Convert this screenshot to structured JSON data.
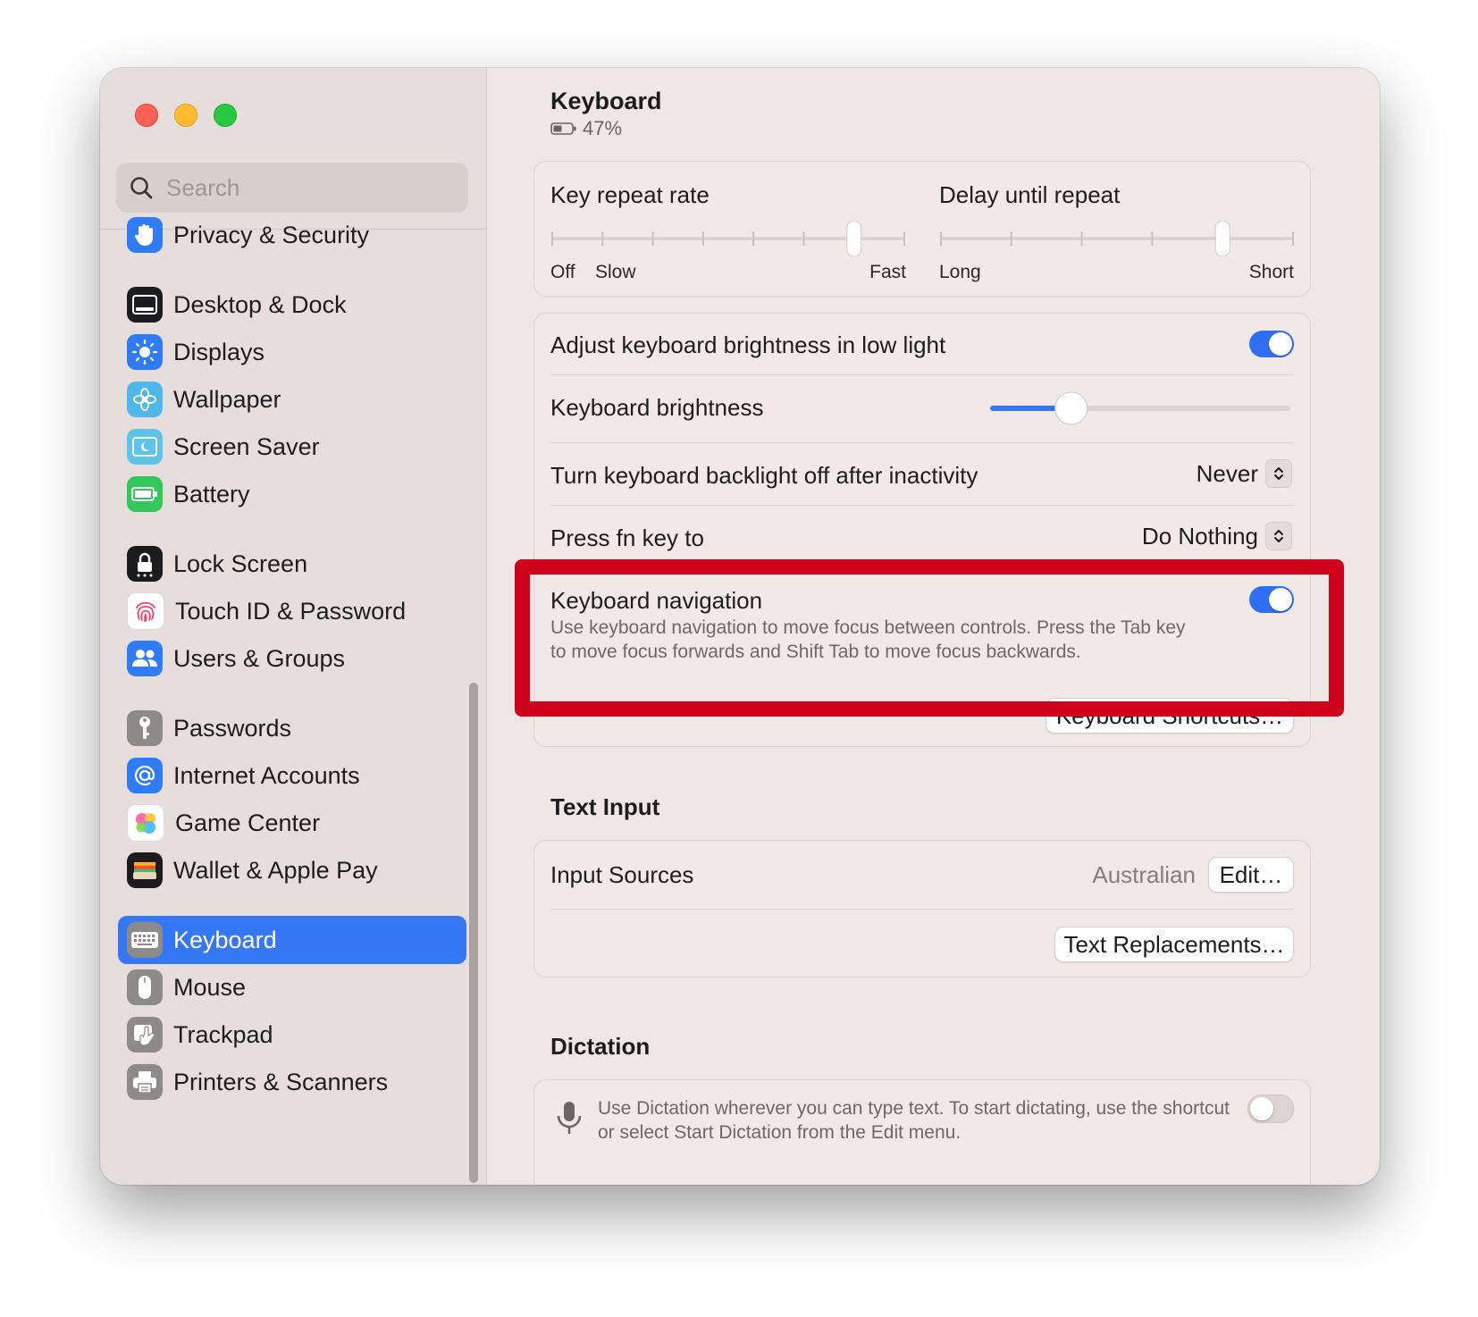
{
  "window": {
    "title": "Keyboard"
  },
  "search": {
    "placeholder": "Search"
  },
  "sidebar": {
    "items": [
      {
        "label": "Privacy & Security",
        "icon": "hand-icon"
      },
      {
        "label": "Desktop & Dock",
        "icon": "dock-icon"
      },
      {
        "label": "Displays",
        "icon": "sun-icon"
      },
      {
        "label": "Wallpaper",
        "icon": "flower-icon"
      },
      {
        "label": "Screen Saver",
        "icon": "screen-saver-icon"
      },
      {
        "label": "Battery",
        "icon": "battery-icon"
      },
      {
        "label": "Lock Screen",
        "icon": "lock-icon"
      },
      {
        "label": "Touch ID & Password",
        "icon": "fingerprint-icon"
      },
      {
        "label": "Users & Groups",
        "icon": "users-icon"
      },
      {
        "label": "Passwords",
        "icon": "key-icon"
      },
      {
        "label": "Internet Accounts",
        "icon": "at-icon"
      },
      {
        "label": "Game Center",
        "icon": "game-center-icon"
      },
      {
        "label": "Wallet & Apple Pay",
        "icon": "wallet-icon"
      },
      {
        "label": "Keyboard",
        "icon": "keyboard-icon",
        "selected": true
      },
      {
        "label": "Mouse",
        "icon": "mouse-icon"
      },
      {
        "label": "Trackpad",
        "icon": "trackpad-icon"
      },
      {
        "label": "Printers & Scanners",
        "icon": "printer-icon"
      }
    ]
  },
  "header": {
    "title": "Keyboard",
    "battery": "47%",
    "battery_level": 0.47
  },
  "repeat": {
    "key_repeat_label": "Key repeat rate",
    "key_repeat_min_label": "Off",
    "key_repeat_slow_label": "Slow",
    "key_repeat_max_label": "Fast",
    "key_repeat_value": 6,
    "key_repeat_ticks": 8,
    "delay_label": "Delay until repeat",
    "delay_min_label": "Long",
    "delay_max_label": "Short",
    "delay_value": 4,
    "delay_ticks": 6
  },
  "settings": {
    "adjust_brightness_label": "Adjust keyboard brightness in low light",
    "adjust_brightness_on": true,
    "brightness_label": "Keyboard brightness",
    "brightness_value": 0.27,
    "backlight_off_label": "Turn keyboard backlight off after inactivity",
    "backlight_off_value": "Never",
    "fn_key_label": "Press fn key to",
    "fn_key_value": "Do Nothing",
    "nav_label": "Keyboard navigation",
    "nav_desc_line1": "Use keyboard navigation to move focus between controls. Press the Tab key",
    "nav_desc_line2": "to move focus forwards and Shift Tab to move focus backwards.",
    "nav_on": true,
    "shortcuts_button": "Keyboard Shortcuts…"
  },
  "text_input": {
    "title": "Text Input",
    "input_sources_label": "Input Sources",
    "input_sources_value": "Australian",
    "edit_button": "Edit…",
    "replacements_button": "Text Replacements…"
  },
  "dictation": {
    "title": "Dictation",
    "desc_line1": "Use Dictation wherever you can type text. To start dictating, use the shortcut",
    "desc_line2": "or select Start Dictation from the Edit menu.",
    "on": false
  },
  "colors": {
    "accent": "#3478f6",
    "highlight": "#d0021b"
  }
}
